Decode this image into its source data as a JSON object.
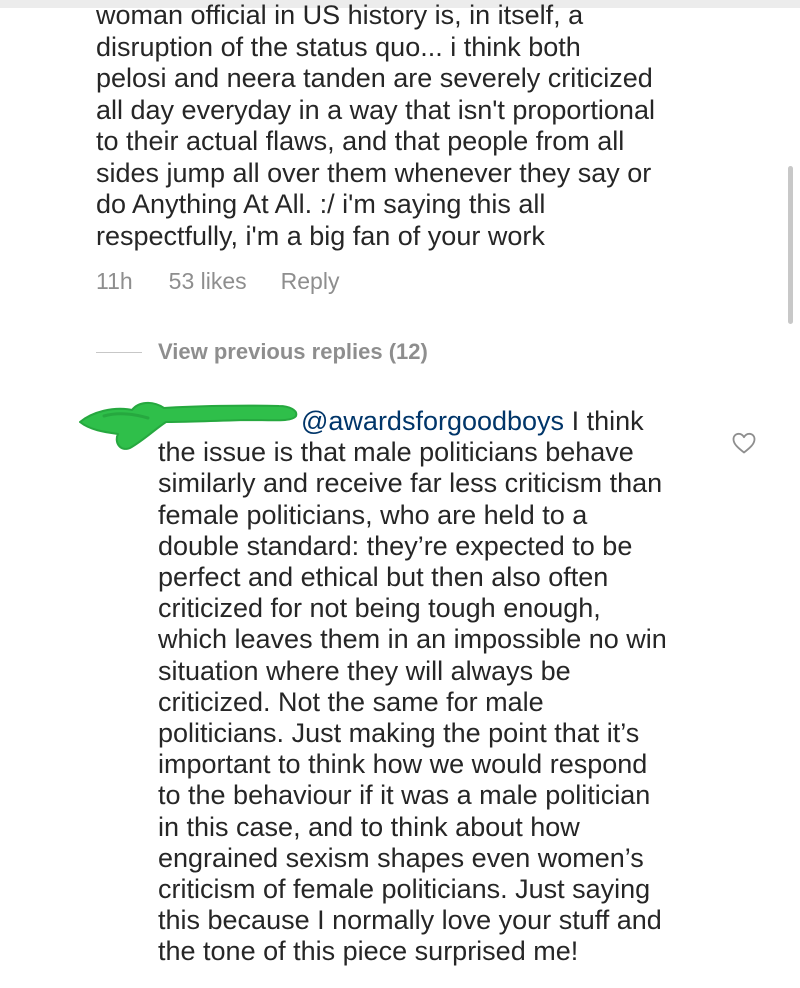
{
  "comment": {
    "lines": [
      "woman official in US history is, in itself, a",
      "disruption of the status quo... i think both",
      "pelosi and neera tanden are severely criticized",
      "all day everyday in a way that isn't proportional",
      "to their actual flaws, and that people from all",
      "sides jump all over them whenever they say or",
      "do Anything At All. :/ i'm saying this all",
      "respectfully, i'm a big fan of your work"
    ],
    "time": "11h",
    "likes": "53 likes",
    "reply_label": "Reply"
  },
  "view_replies": {
    "label": "View previous replies (12)"
  },
  "reply": {
    "mention": "@awardsforgoodboys",
    "first_line_rest": " I think",
    "lines": [
      "the issue is that male politicians behave",
      "similarly and receive far less criticism than",
      "female politicians, who are held to a",
      "double standard: they’re expected to be",
      "perfect and ethical but then also often",
      "criticized for not being tough enough,",
      "which leaves them in an impossible no win",
      "situation where they will always be",
      "criticized. Not the same for male",
      "politicians. Just making the point that it’s",
      "important to think how we would respond",
      "to the behaviour if it was a male politician",
      "in this case, and to think about how",
      "engrained sexism shapes even women’s",
      "criticism of female politicians. Just saying",
      "this because I normally love your stuff and",
      "the tone of this piece surprised me!"
    ]
  },
  "icons": {
    "like": "heart-outline-icon"
  },
  "colors": {
    "text": "#262626",
    "secondary": "#8e8e8e",
    "mention": "#003569",
    "redaction": "#2fbf4a"
  }
}
